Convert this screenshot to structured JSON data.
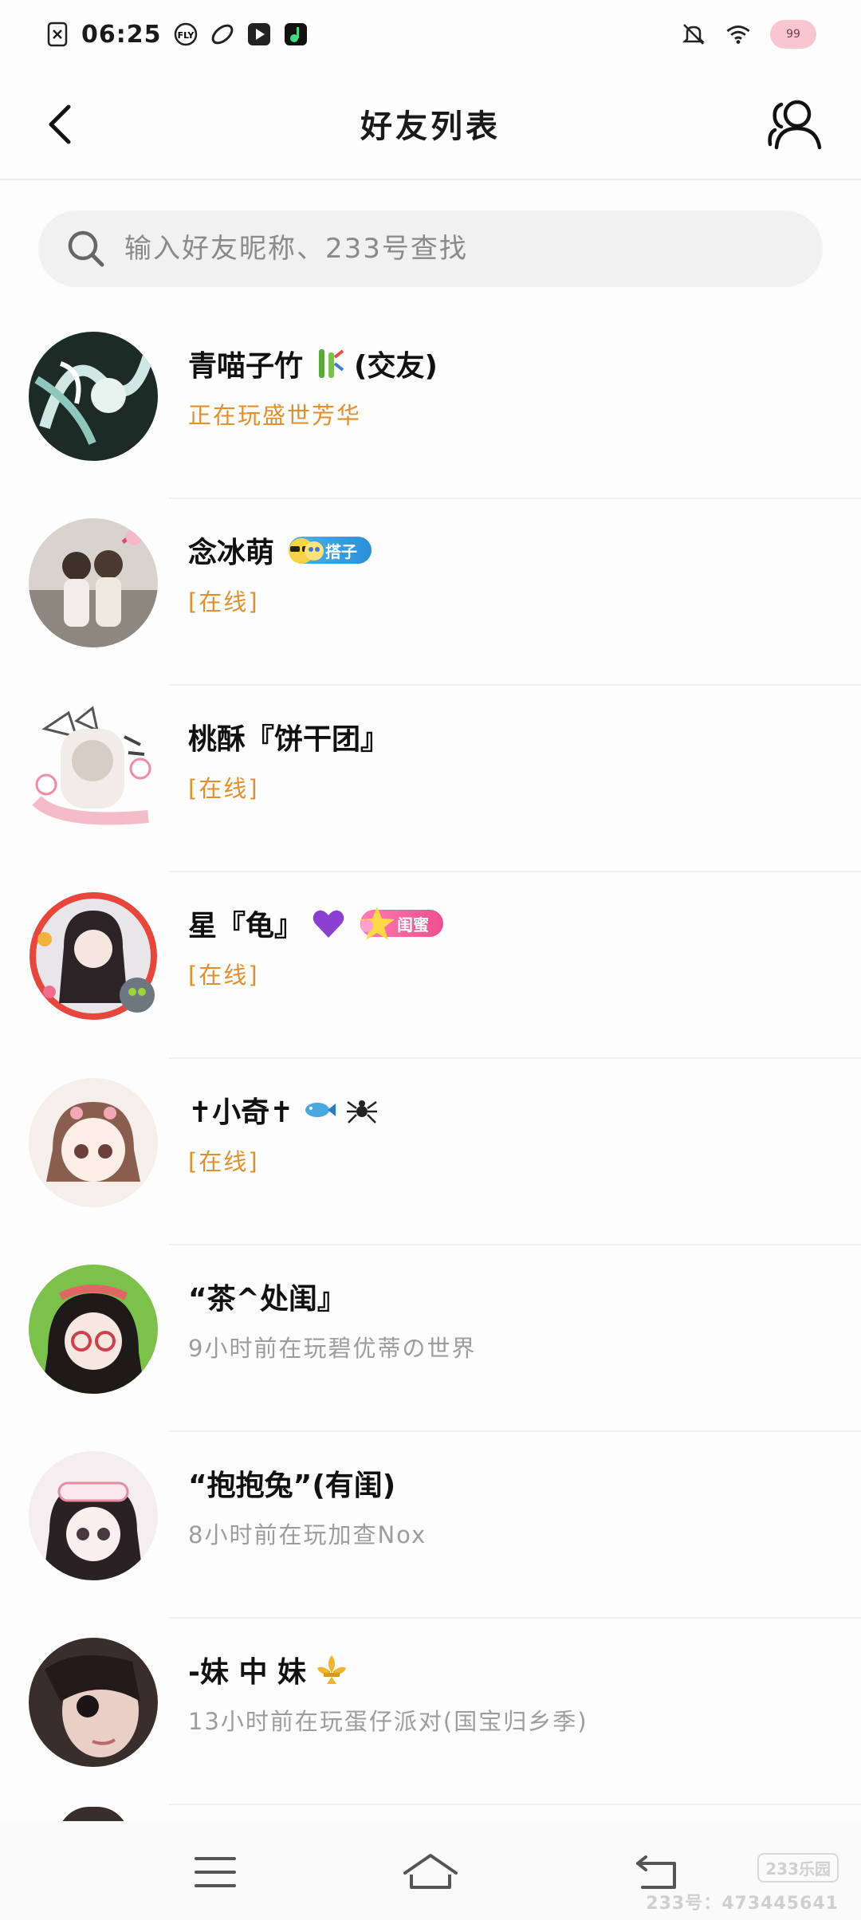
{
  "status_bar": {
    "time": "06:25",
    "badge": "99"
  },
  "header": {
    "title": "好友列表"
  },
  "search": {
    "placeholder": "输入好友昵称、233号查找"
  },
  "friends": [
    {
      "name": "青喵子竹",
      "name_suffix": "(交友)",
      "status": "正在玩盛世芳华",
      "online": true,
      "emoji": "bamboo-icon"
    },
    {
      "name": "念冰萌",
      "status": "[在线]",
      "online": true,
      "tag": "搭子",
      "tag_color": "#2b8fd6",
      "emoji": "sunglasses-icon"
    },
    {
      "name": "桃酥『饼干团』",
      "status": "[在线]",
      "online": true
    },
    {
      "name": "星『龟』",
      "status": "[在线]",
      "online": true,
      "tag": "闺蜜",
      "tag_color": "#ef4f8f",
      "emoji": "purple-heart-icon"
    },
    {
      "name": "✝小奇✝",
      "status": "[在线]",
      "online": true,
      "emoji": "fish-spider-icon"
    },
    {
      "name": "“茶^处闺』",
      "status": "9小时前在玩碧优蒂の世界",
      "online": false
    },
    {
      "name": "“抱抱兔”(有闺)",
      "status": "8小时前在玩加查Nox",
      "online": false
    },
    {
      "name": "-妹 中 妹",
      "status": "13小时前在玩蛋仔派对(国宝归乡季)",
      "online": false,
      "emoji": "fleur-de-lis-icon"
    }
  ],
  "watermark": {
    "logo": "233乐园",
    "id": "233号：473445641"
  },
  "colors": {
    "online": "#e0902e",
    "offline": "#9d9d9d",
    "search_bg": "#f1f1f1"
  }
}
